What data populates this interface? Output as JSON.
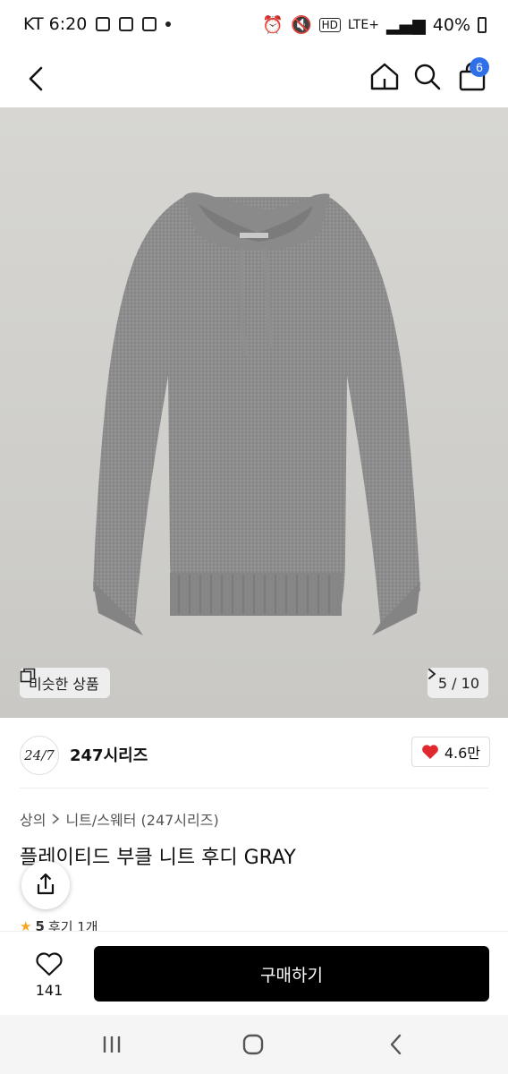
{
  "status_bar": {
    "carrier_time": "KT 6:20",
    "network": "LTE+",
    "hd": "HD",
    "battery": "40%"
  },
  "nav": {
    "cart_count": "6"
  },
  "hero": {
    "similar_label": "비슷한 상품",
    "page_indicator": "5 / 10"
  },
  "brand": {
    "logo_text": "24/7",
    "name": "247시리즈",
    "likes": "4.6만"
  },
  "product": {
    "breadcrumb": [
      "상의",
      "니트/스웨터 (247시리즈)"
    ],
    "title": "플레이티드 부클 니트 후디 GRAY",
    "rating": "5",
    "review_text": "후기 1개"
  },
  "bottom": {
    "wish_count": "141",
    "buy_label": "구매하기"
  },
  "colors": {
    "accent_badge": "#2f6fe8",
    "buy_button": "#000000",
    "heart": "#e0282e",
    "star": "#f5a623"
  }
}
